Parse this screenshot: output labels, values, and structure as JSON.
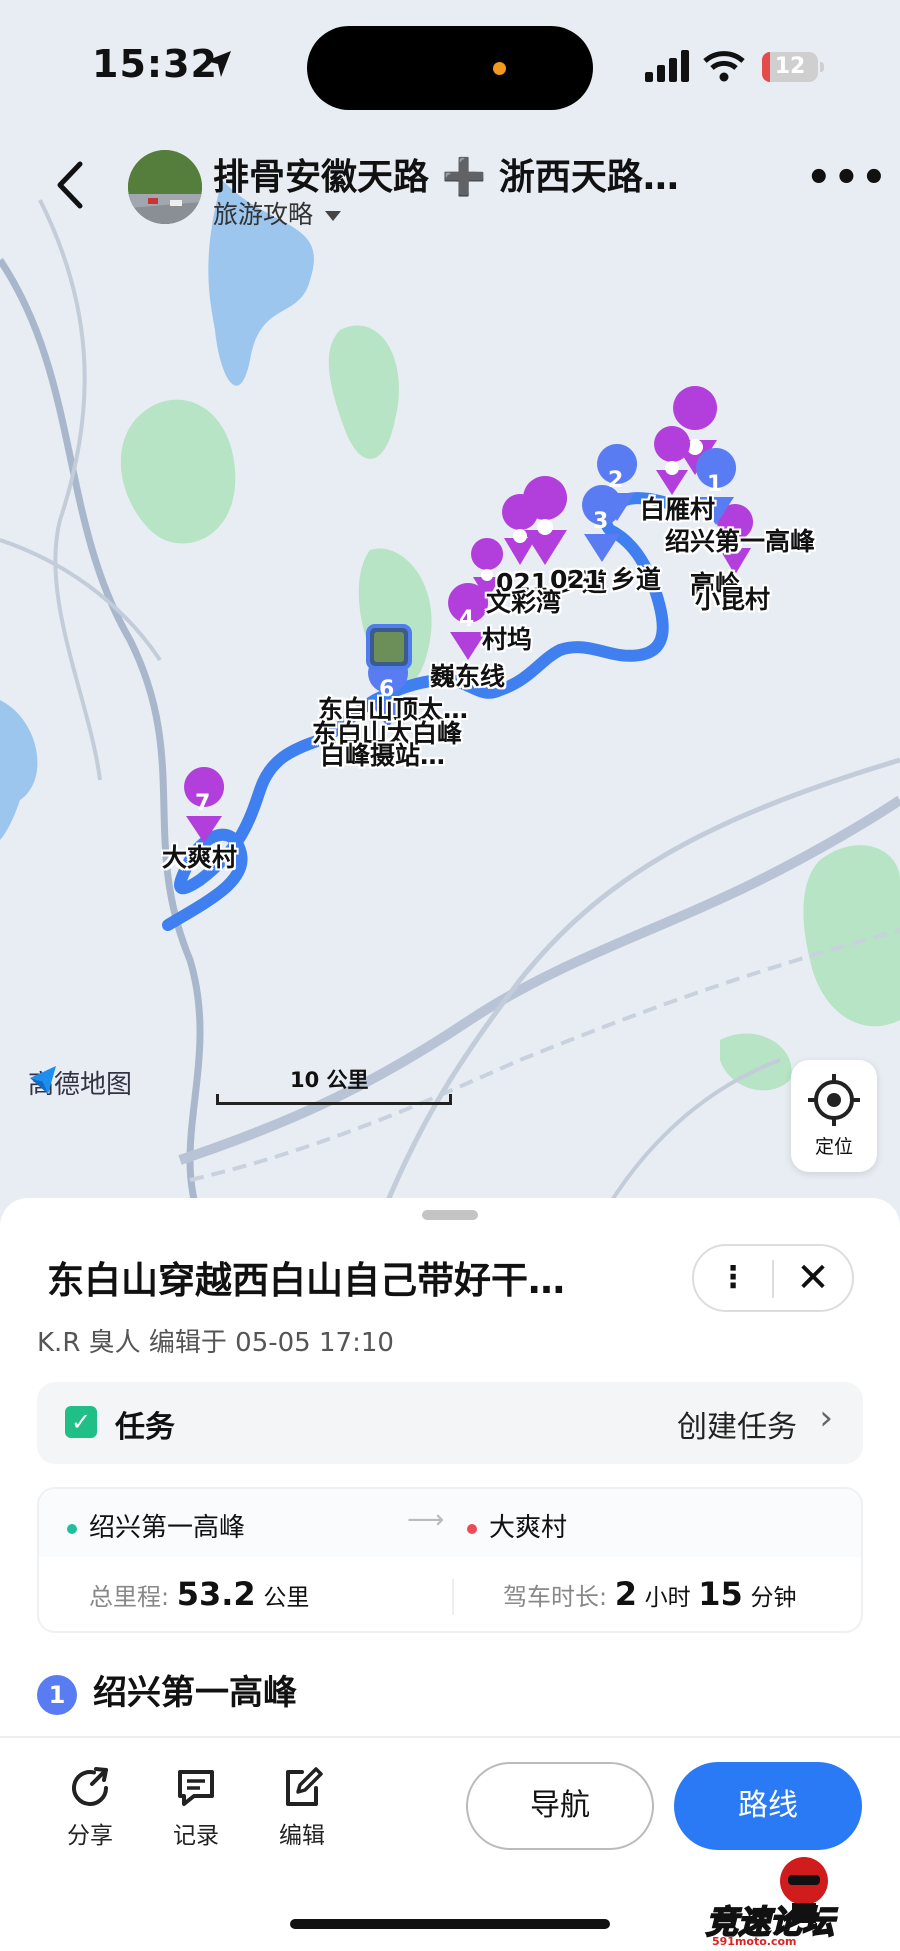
{
  "status_bar": {
    "time": "15:32",
    "battery": "12"
  },
  "header": {
    "title": "排骨安徽天路 ➕ 浙西天路…",
    "subtitle": "旅游攻略"
  },
  "map": {
    "labels": {
      "l1": "白雁村",
      "l2": "绍兴第一高峰",
      "l3": "高岭",
      "l4": "小昆村",
      "l5": "021 乡道",
      "l6": "021 乡道",
      "l7": "文彩湾",
      "l8": "村坞",
      "l9": "巍东线",
      "l10": "东白山顶太…",
      "l11": "东白山太白峰",
      "l12": "白峰摄站…",
      "l13": "大爽村"
    },
    "markers": [
      "1",
      "2",
      "3",
      "4",
      "6",
      "7"
    ],
    "brand": "高德地图",
    "scale": "10 公里",
    "locate_label": "定位"
  },
  "sheet": {
    "title": "东白山穿越西白山自己带好干…",
    "author": "K.R 臭人  编辑于  05-05 17:10",
    "task_label": "任务",
    "task_action": "创建任务",
    "start": "绍兴第一高峰",
    "end": "大爽村",
    "distance_label": "总里程:",
    "distance_value": "53.2",
    "distance_unit": "公里",
    "duration_label": "驾车时长:",
    "duration_hours": "2",
    "hours_unit": "小时",
    "duration_minutes": "15",
    "minutes_unit": "分钟",
    "first_waypoint_num": "1",
    "first_waypoint": "绍兴第一高峰"
  },
  "toolbar": {
    "share": "分享",
    "record": "记录",
    "edit": "编辑",
    "navigate": "导航",
    "route": "路线"
  },
  "watermark": {
    "text": "竞速论坛",
    "sub": "591moto.com"
  }
}
